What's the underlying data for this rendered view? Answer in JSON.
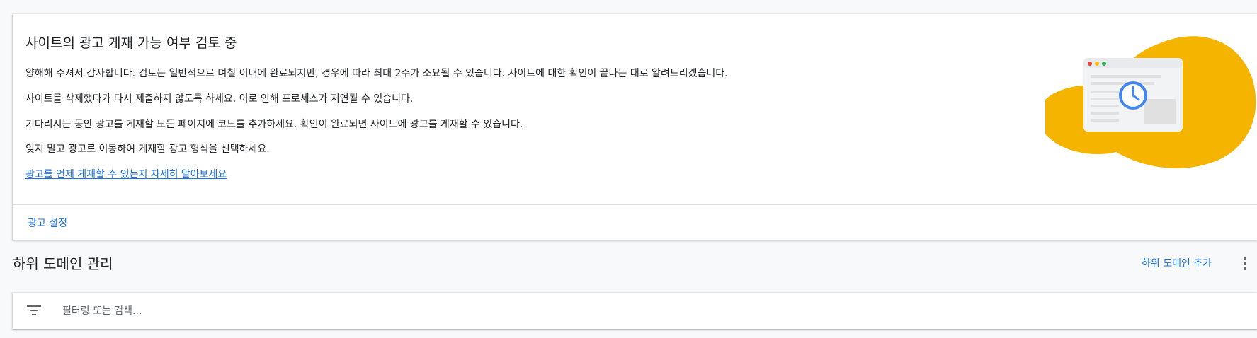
{
  "review": {
    "title": "사이트의 광고 게재 가능 여부 검토 중",
    "paragraphs": [
      "양해해 주셔서 감사합니다. 검토는 일반적으로 며칠 이내에 완료되지만, 경우에 따라 최대 2주가 소요될 수 있습니다. 사이트에 대한 확인이 끝나는 대로 알려드리겠습니다.",
      "사이트를 삭제했다가 다시 제출하지 않도록 하세요. 이로 인해 프로세스가 지연될 수 있습니다.",
      "기다리시는 동안 광고를 게재할 모든 페이지에 코드를 추가하세요. 확인이 완료되면 사이트에 광고를 게재할 수 있습니다.",
      "잊지 말고 광고로 이동하여 게재할 광고 형식을 선택하세요."
    ],
    "learn_more_link": "광고를 언제 게재할 수 있는지 자세히 알아보세요",
    "ads_settings_button": "광고 설정",
    "illustration_icon": "clock-window-illustration",
    "colors": {
      "blob": "#f4b400",
      "clock": "#4285f4",
      "link": "#1a73e8"
    }
  },
  "subdomains": {
    "title": "하위 도메인 관리",
    "add_button": "하위 도메인 추가",
    "more_icon": "more-vert-icon",
    "filter": {
      "icon": "filter-list-icon",
      "placeholder": "필터링 또는 검색...",
      "value": ""
    }
  }
}
